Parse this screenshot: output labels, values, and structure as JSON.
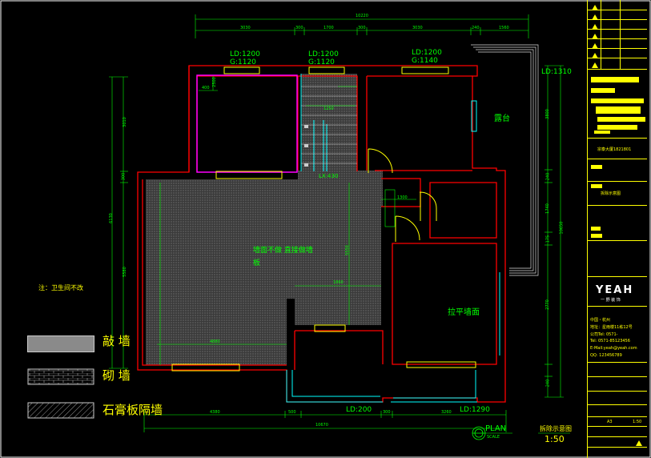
{
  "drawing": {
    "total_width_top": "10220",
    "total_width_bottom": "10670",
    "top_segments": [
      "3030",
      "300",
      "1700",
      "300",
      "3030",
      "240",
      "1560"
    ],
    "bottom_segments": [
      "4380",
      "500",
      "LD:200",
      "300",
      "3260",
      "LD:1290"
    ],
    "left_dims": [
      "3010",
      "300",
      "6130",
      "5580"
    ],
    "right_dims": [
      "3800",
      "LD:1310",
      "240",
      "1740",
      "175",
      "10650",
      "2770",
      "240"
    ],
    "windows": [
      {
        "ld": "LD:1200",
        "g": "G:1120"
      },
      {
        "ld": "LD:1200",
        "g": "G:1120"
      },
      {
        "ld": "LD:1200",
        "g": "G:1140"
      }
    ],
    "door_dim": "LX:430",
    "inner_dims": [
      "1250",
      "400",
      "2500",
      "1860",
      "4880",
      "1300",
      "5550"
    ],
    "room_labels": {
      "balcony": "露台",
      "center_note_1": "墙面不做 直接做墙",
      "center_note_2": "板",
      "right_wall": "拉平墙面"
    },
    "note": "注：卫生间不改",
    "plan_title": "PLAN",
    "plan_scale": "SCALE",
    "plan_name": "拆除示意图",
    "plan_ratio": "1:50"
  },
  "legend": [
    {
      "label": "敲 墙",
      "pattern": "solid-gray"
    },
    {
      "label": "砌 墙",
      "pattern": "brick"
    },
    {
      "label": "石膏板隔墙",
      "pattern": "hatch"
    }
  ],
  "title_block": {
    "project": "宗泰大厦1821801",
    "drawing_name": "拆除示意图",
    "company_logo": "YEAH",
    "company_sub": "一 野 装 饰",
    "company_lines": [
      "中国・杭州",
      "地址：星雨楼11栋12号",
      "公司Tel: 0571-",
      "Tel: 0571-85123456",
      "E-Mail:yeah@yeah.com",
      "QQ: 123456789"
    ],
    "sheet_size": "A3",
    "scale": "1:50"
  },
  "colors": {
    "background": "#000000",
    "wall_red": "#ff0000",
    "dimension_green": "#00ff00",
    "text_yellow": "#ffff00",
    "magenta": "#ff00ff",
    "cyan": "#00ffff",
    "white": "#ffffff"
  }
}
